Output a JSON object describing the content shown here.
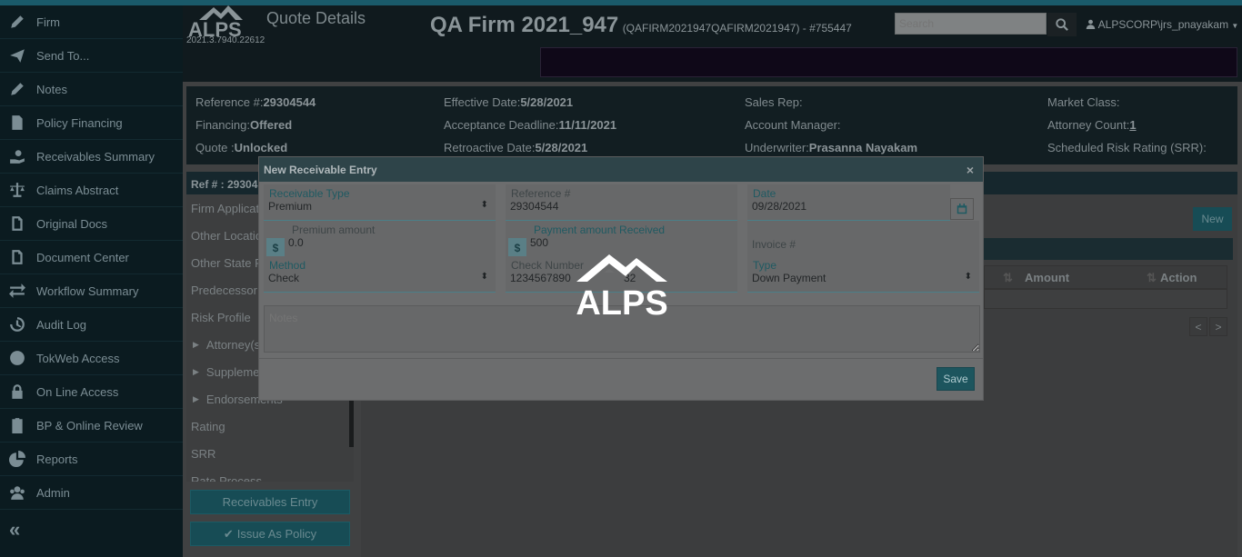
{
  "sidebar": {
    "items": [
      {
        "label": "Firm",
        "icon": "pencil-icon"
      },
      {
        "label": "Send To...",
        "icon": "paper-plane-icon"
      },
      {
        "label": "Notes",
        "icon": "pencil-icon"
      },
      {
        "label": "Policy Financing",
        "icon": "document-icon"
      },
      {
        "label": "Receivables Summary",
        "icon": "hand-money-icon"
      },
      {
        "label": "Claims Abstract",
        "icon": "scales-icon"
      },
      {
        "label": "Original Docs",
        "icon": "file-icon"
      },
      {
        "label": "Document Center",
        "icon": "file-icon"
      },
      {
        "label": "Workflow Summary",
        "icon": "exchange-icon"
      },
      {
        "label": "Audit Log",
        "icon": "history-icon"
      },
      {
        "label": "TokWeb Access",
        "icon": "globe-icon"
      },
      {
        "label": "On Line Access",
        "icon": "lock-icon"
      },
      {
        "label": "BP & Online Review",
        "icon": "clipboard-icon"
      },
      {
        "label": "Reports",
        "icon": "pie-chart-icon"
      },
      {
        "label": "Admin",
        "icon": "users-icon"
      }
    ],
    "collapse": "«"
  },
  "header": {
    "logo": "ALPS",
    "version": "2021.3.7940.22612",
    "page_title": "Quote Details",
    "firm_name": "QA Firm 2021_947",
    "firm_sub": "(QAFIRM2021947QAFIRM2021947) - #755447",
    "search_placeholder": "Search",
    "user": "ALPSCORP\\jrs_pnayakam"
  },
  "info": {
    "reference_label": "Reference #:",
    "reference_value": "29304544",
    "financing_label": "Financing:",
    "financing_value": "Offered",
    "quote_label": "Quote :",
    "quote_value": "Unlocked",
    "effective_label": "Effective Date:",
    "effective_value": "5/28/2021",
    "acceptance_label": "Acceptance Deadline:",
    "acceptance_value": "11/11/2021",
    "retroactive_label": "Retroactive Date:",
    "retroactive_value": "5/28/2021",
    "sales_rep_label": "Sales Rep:",
    "account_manager_label": "Account Manager:",
    "underwriter_label": "Underwriter:",
    "underwriter_value": "Prasanna Nayakam",
    "market_class_label": "Market Class:",
    "attorney_count_label": "Attorney Count:",
    "attorney_count_value": "1",
    "srr_label": "Scheduled Risk Rating (SRR):"
  },
  "ref_panel": {
    "header": "Ref # : 29304",
    "items": [
      {
        "label": "Firm Applicat",
        "caret": false
      },
      {
        "label": "Other Locatio",
        "caret": false
      },
      {
        "label": "Other State P",
        "caret": false
      },
      {
        "label": "Predecessor F",
        "caret": false
      },
      {
        "label": "Risk Profile",
        "caret": false
      },
      {
        "label": "Attorney(s)",
        "caret": true
      },
      {
        "label": "Suppleme",
        "caret": true
      },
      {
        "label": "Endorsements",
        "caret": true
      },
      {
        "label": "Rating",
        "caret": false
      },
      {
        "label": "SRR",
        "caret": false
      },
      {
        "label": "Rate Process",
        "caret": false
      }
    ],
    "receivables_btn": "Receivables Entry",
    "issue_btn": "Issue As Policy"
  },
  "main": {
    "new_btn": "New",
    "col_amount": "Amount",
    "col_action": "Action",
    "prev": "<",
    "next": ">"
  },
  "modal": {
    "title": "New Receivable Entry",
    "close": "×",
    "receivable_type_label": "Receivable Type",
    "receivable_type_value": "Premium",
    "reference_label": "Reference #",
    "reference_value": "29304544",
    "date_label": "Date",
    "date_value": "09/28/2021",
    "premium_label": "Premium amount",
    "premium_value": "0.0",
    "payment_label": "Payment amount Received",
    "payment_value": "500",
    "invoice_placeholder": "Invoice #",
    "method_label": "Method",
    "method_value": "Check",
    "check_label": "Check Number",
    "check_value": "1234567890",
    "check_tail": "32",
    "type_label": "Type",
    "type_value": "Down Payment",
    "notes_placeholder": "Notes",
    "save": "Save"
  },
  "overlay_logo": "ALPS"
}
